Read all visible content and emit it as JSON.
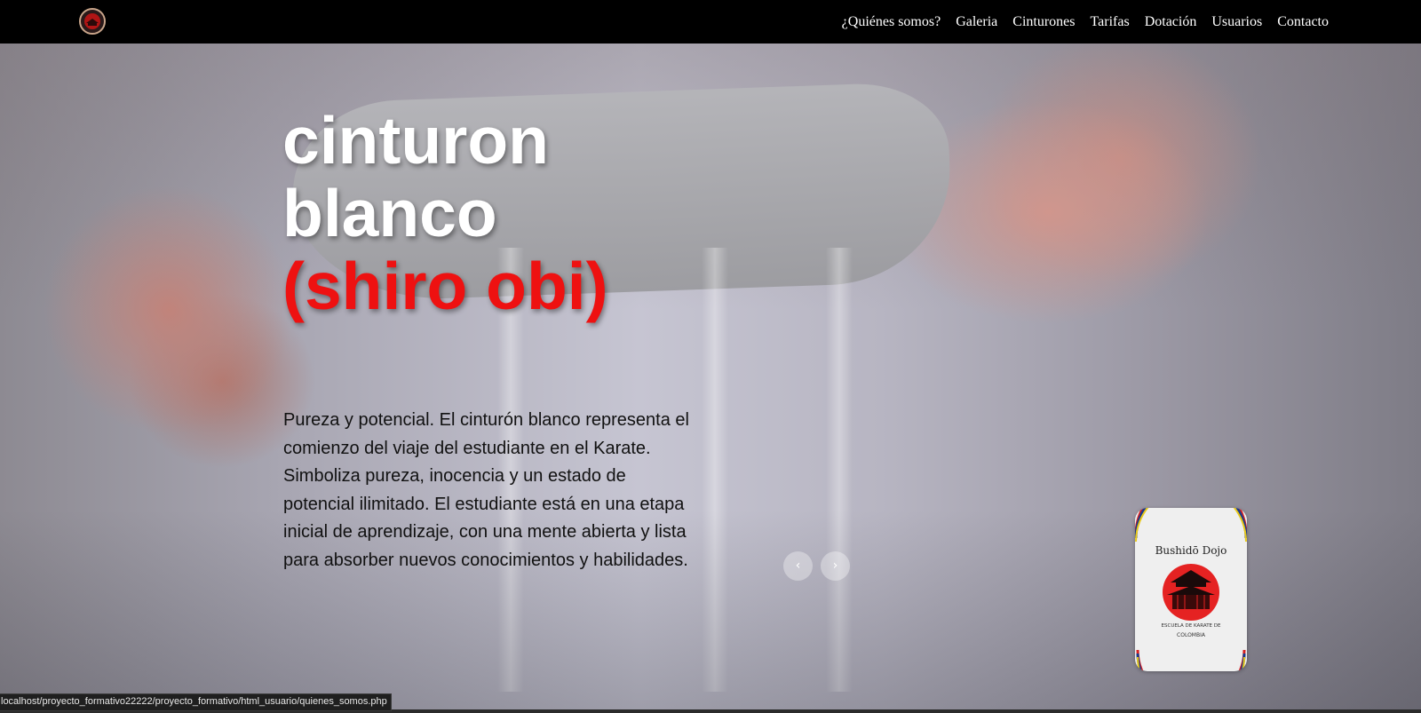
{
  "nav": {
    "logo": "dojo-logo",
    "links": [
      "¿Quiénes somos?",
      "Galeria",
      "Cinturones",
      "Tarifas",
      "Dotación",
      "Usuarios",
      "Contacto"
    ]
  },
  "hero": {
    "title_line1": "cinturon",
    "title_line2": "blanco",
    "title_accent": "(shiro obi)",
    "description": "Pureza y potencial. El cinturón blanco representa el comienzo del viaje del estudiante en el Karate. Simboliza pureza, inocencia y un estado de potencial ilimitado. El estudiante está en una etapa inicial de aprendizaje, con una mente abierta y lista para absorber nuevos conocimientos y habilidades."
  },
  "carousel": {
    "prev_icon": "chevron-left-icon",
    "prev_label": "‹",
    "next_icon": "chevron-right-icon",
    "next_label": "›"
  },
  "dojo_card": {
    "name": "Bushidō Dojo",
    "tagline": "ESCUELA DE KARATE DE",
    "country": "COLOMBIA"
  },
  "status_bar": {
    "url": "localhost/proyecto_formativo22222/proyecto_formativo/html_usuario/quienes_somos.php"
  },
  "colors": {
    "accent_red": "#ee1111",
    "navbar_bg": "#000000"
  }
}
